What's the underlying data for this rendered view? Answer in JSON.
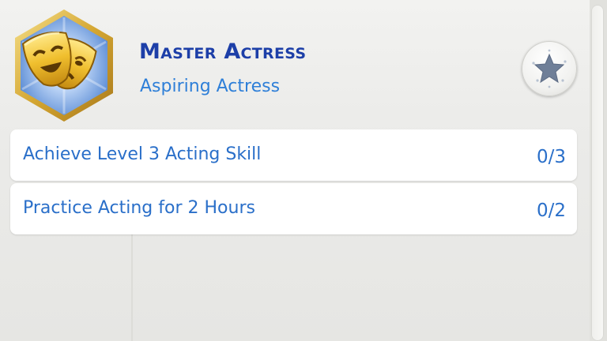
{
  "aspiration": {
    "title": "Master Actress",
    "subtitle": "Aspiring Actress",
    "icon": "theater-masks-icon",
    "accent_color": "#1d3fa8"
  },
  "reward_button": {
    "icon": "star-icon"
  },
  "objectives": [
    {
      "label": "Achieve Level 3 Acting Skill",
      "progress": "0/3"
    },
    {
      "label": "Practice Acting for 2 Hours",
      "progress": "0/2"
    }
  ],
  "colors": {
    "title": "#1d3fa8",
    "text": "#2a6fc9",
    "panel_background": "#ebebe9",
    "row_background": "#ffffff"
  }
}
